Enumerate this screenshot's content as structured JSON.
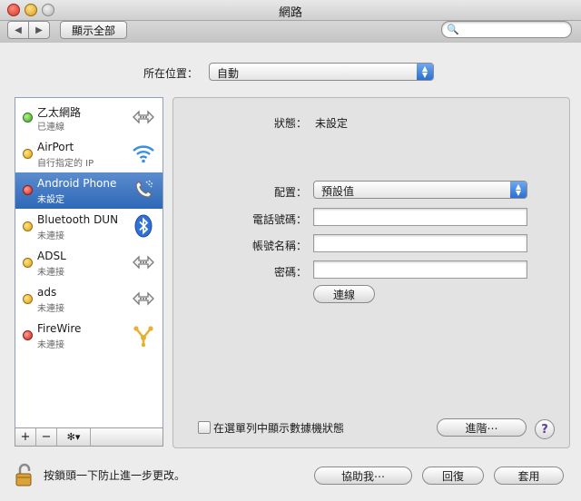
{
  "window": {
    "title": "網路"
  },
  "toolbar": {
    "back_label": "◀",
    "forward_label": "▶",
    "show_all_label": "顯示全部",
    "search_placeholder": ""
  },
  "location": {
    "label": "所在位置：",
    "value": "自動"
  },
  "services": [
    {
      "name": "乙太網路",
      "status": "已連線",
      "status_color": "green",
      "icon": "ethernet-icon",
      "selected": false
    },
    {
      "name": "AirPort",
      "status": "自行指定的 IP",
      "status_color": "yellow",
      "icon": "wifi-icon",
      "selected": false
    },
    {
      "name": "Android Phone",
      "status": "未設定",
      "status_color": "red",
      "icon": "phone-icon",
      "selected": true
    },
    {
      "name": "Bluetooth DUN",
      "status": "未連接",
      "status_color": "yellow",
      "icon": "bluetooth-icon",
      "selected": false
    },
    {
      "name": "ADSL",
      "status": "未連接",
      "status_color": "yellow",
      "icon": "ethernet-icon",
      "selected": false
    },
    {
      "name": "ads",
      "status": "未連接",
      "status_color": "yellow",
      "icon": "ethernet-icon",
      "selected": false
    },
    {
      "name": "FireWire",
      "status": "未連接",
      "status_color": "red",
      "icon": "firewire-icon",
      "selected": false
    }
  ],
  "sidebar_buttons": {
    "add": "+",
    "remove": "−",
    "gear": "✻▾"
  },
  "detail": {
    "status_label": "狀態：",
    "status_value": "未設定",
    "config_label": "配置：",
    "config_value": "預設值",
    "phone_label": "電話號碼：",
    "phone_value": "",
    "account_label": "帳號名稱：",
    "account_value": "",
    "password_label": "密碼：",
    "password_value": "",
    "connect_button": "連線",
    "show_modem_status_label": "在選單列中顯示數據機狀態",
    "advanced_button": "進階⋯",
    "help_label": "?"
  },
  "bottom": {
    "lock_text": "按鎖頭一下防止進一步更改。",
    "assist_button": "協助我⋯",
    "revert_button": "回復",
    "apply_button": "套用"
  },
  "colors": {
    "selection": "#3a73c2",
    "accent_blue": "#2c6fd1"
  }
}
